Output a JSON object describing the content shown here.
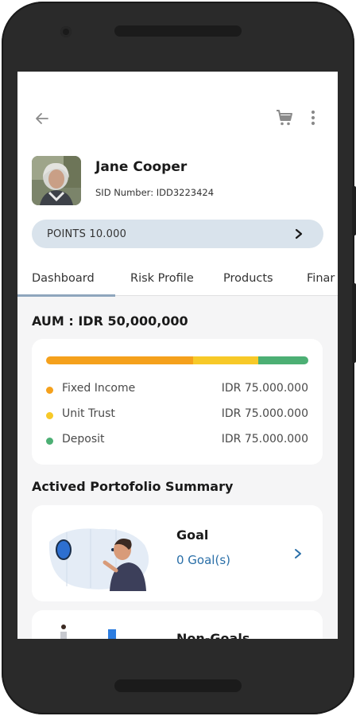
{
  "profile": {
    "name": "Jane Cooper",
    "sid": "SID Number: IDD3223424"
  },
  "points": {
    "label": "POINTS 10.000"
  },
  "tabs": [
    {
      "label": "Dashboard",
      "active": true
    },
    {
      "label": "Risk Profile",
      "active": false
    },
    {
      "label": "Products",
      "active": false
    },
    {
      "label": "Finar",
      "active": false
    }
  ],
  "aum": {
    "label": "AUM : IDR 50,000,000"
  },
  "allocation": {
    "segments": [
      {
        "name": "Fixed Income",
        "value": "IDR 75.000.000",
        "color": "#f5a11c",
        "share": 0.56
      },
      {
        "name": "Unit Trust",
        "value": "IDR 75.000.000",
        "color": "#f7c928",
        "share": 0.25
      },
      {
        "name": "Deposit",
        "value": "IDR 75.000.000",
        "color": "#4caf74",
        "share": 0.19
      }
    ]
  },
  "summary": {
    "title": "Actived Portofolio Summary",
    "goal": {
      "title": "Goal",
      "subtitle": "0 Goal(s)"
    },
    "non_goal": {
      "title": "Non-Goals"
    }
  },
  "icons": {
    "back": "arrow-left-icon",
    "cart": "cart-icon",
    "more": "more-vertical-icon",
    "chevron": "chevron-right-icon"
  },
  "colors": {
    "accent_blue": "#2a6fa8",
    "points_bg": "#d9e3ec",
    "tab_underline": "#8fa6bd"
  }
}
